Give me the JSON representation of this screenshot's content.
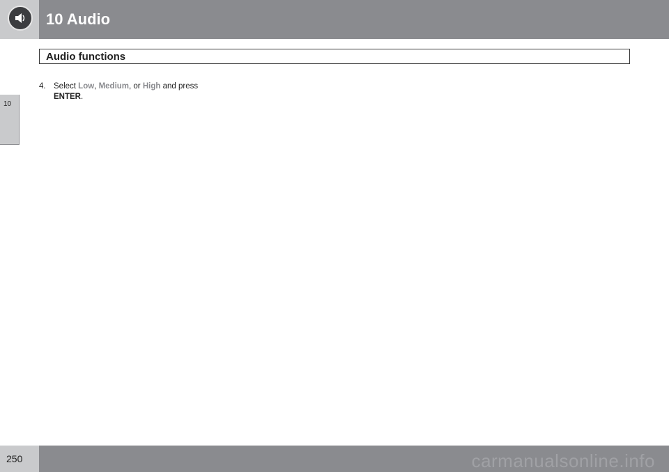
{
  "header": {
    "chapter_title": "10 Audio",
    "icon": "speaker-icon"
  },
  "section": {
    "title": "Audio functions"
  },
  "side_tab": {
    "label": "10"
  },
  "step": {
    "number": "4.",
    "text_select": "Select ",
    "option_low": "Low",
    "sep1": ", ",
    "option_medium": "Medium",
    "sep2": ", or ",
    "option_high": "High",
    "text_and_press": " and press",
    "key_enter": "ENTER",
    "period": "."
  },
  "footer": {
    "page_number": "250",
    "watermark": "carmanualsonline.info"
  },
  "colors": {
    "header_bar": "#8a8b8f",
    "header_left": "#c9cacc",
    "highlight_text": "#8a8b8f"
  }
}
